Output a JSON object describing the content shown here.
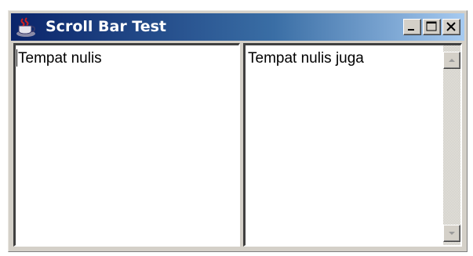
{
  "window": {
    "title": "Scroll Bar Test",
    "icon": "java-cup-icon",
    "controls": [
      "minimize-icon",
      "maximize-icon",
      "close-icon"
    ],
    "title_gradient": [
      "#0a246a",
      "#3a6ea5",
      "#a6caf0"
    ]
  },
  "left_textarea": {
    "text": "Tempat nulis"
  },
  "right_textarea": {
    "text": "Tempat nulis juga",
    "scrollbar": {
      "orientation": "vertical",
      "up_icon": "arrow-up-icon",
      "down_icon": "arrow-down-icon"
    }
  }
}
